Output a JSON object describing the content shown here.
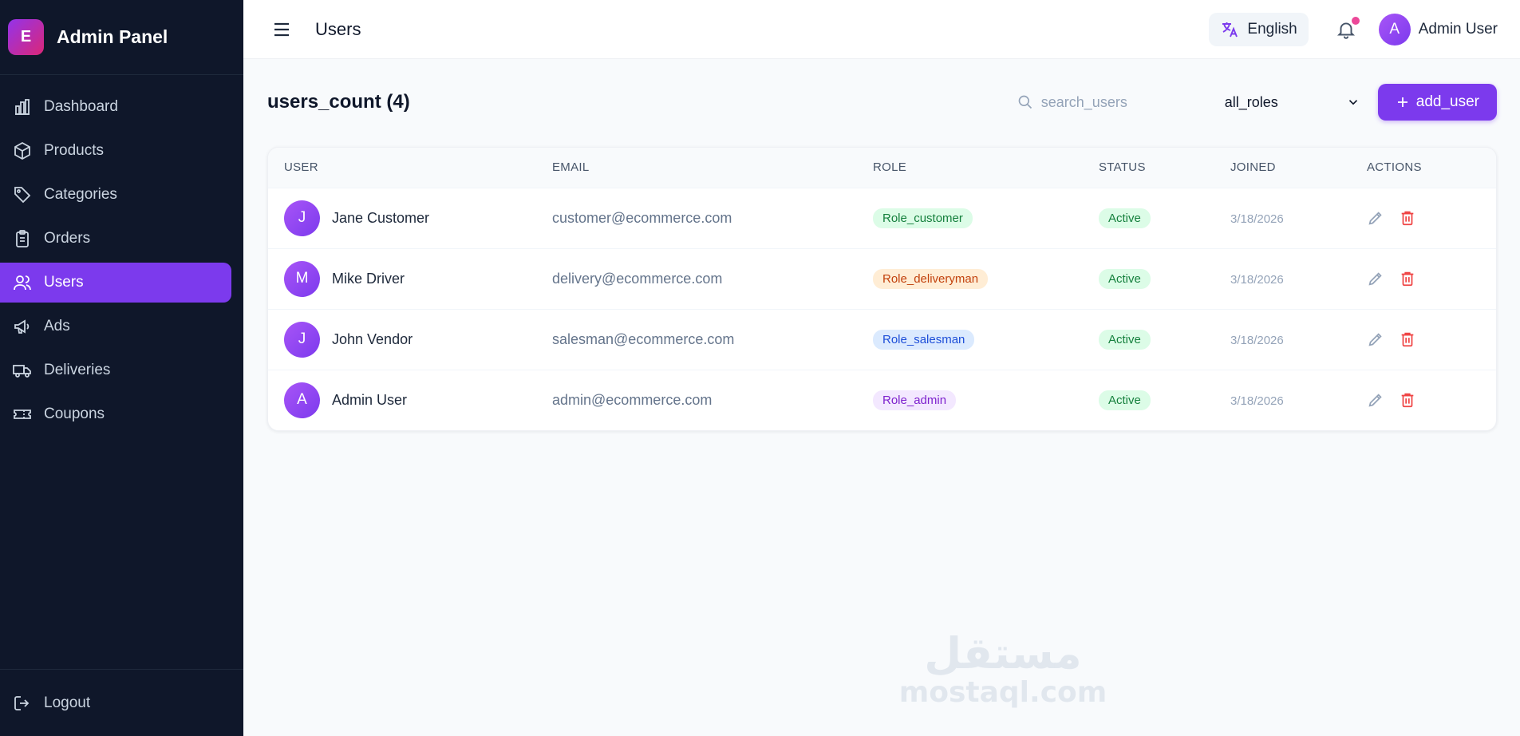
{
  "brand": {
    "logo_letter": "E",
    "title": "Admin Panel"
  },
  "sidebar": {
    "items": [
      {
        "label": "Dashboard",
        "icon": "bar-chart-icon",
        "active": false
      },
      {
        "label": "Products",
        "icon": "box-icon",
        "active": false
      },
      {
        "label": "Categories",
        "icon": "tag-icon",
        "active": false
      },
      {
        "label": "Orders",
        "icon": "clipboard-icon",
        "active": false
      },
      {
        "label": "Users",
        "icon": "users-icon",
        "active": true
      },
      {
        "label": "Ads",
        "icon": "megaphone-icon",
        "active": false
      },
      {
        "label": "Deliveries",
        "icon": "truck-icon",
        "active": false
      },
      {
        "label": "Coupons",
        "icon": "ticket-icon",
        "active": false
      }
    ],
    "logout_label": "Logout"
  },
  "header": {
    "title": "Users",
    "language": "English",
    "user_initial": "A",
    "user_name": "Admin User"
  },
  "toolbar": {
    "count_title": "users_count (4)",
    "search_placeholder": "search_users",
    "role_filter": "all_roles",
    "add_label": "add_user"
  },
  "table": {
    "columns": [
      "USER",
      "EMAIL",
      "ROLE",
      "STATUS",
      "JOINED",
      "ACTIONS"
    ],
    "rows": [
      {
        "initial": "J",
        "name": "Jane Customer",
        "email": "customer@ecommerce.com",
        "role": "Role_customer",
        "status": "Active",
        "joined": "3/18/2026"
      },
      {
        "initial": "M",
        "name": "Mike Driver",
        "email": "delivery@ecommerce.com",
        "role": "Role_deliveryman",
        "status": "Active",
        "joined": "3/18/2026"
      },
      {
        "initial": "J",
        "name": "John Vendor",
        "email": "salesman@ecommerce.com",
        "role": "Role_salesman",
        "status": "Active",
        "joined": "3/18/2026"
      },
      {
        "initial": "A",
        "name": "Admin User",
        "email": "admin@ecommerce.com",
        "role": "Role_admin",
        "status": "Active",
        "joined": "3/18/2026"
      }
    ]
  },
  "role_colors": {
    "Role_customer": {
      "bg": "#dcfce7",
      "fg": "#15803d"
    },
    "Role_deliveryman": {
      "bg": "#ffedd5",
      "fg": "#c2410c"
    },
    "Role_salesman": {
      "bg": "#dbeafe",
      "fg": "#1d4ed8"
    },
    "Role_admin": {
      "bg": "#f3e8ff",
      "fg": "#7e22ce"
    }
  },
  "status_colors": {
    "Active": {
      "bg": "#dcfce7",
      "fg": "#15803d"
    }
  },
  "accent_color": "#7c3aed",
  "watermark": {
    "arabic": "مستقل",
    "latin": "mostaql.com"
  }
}
